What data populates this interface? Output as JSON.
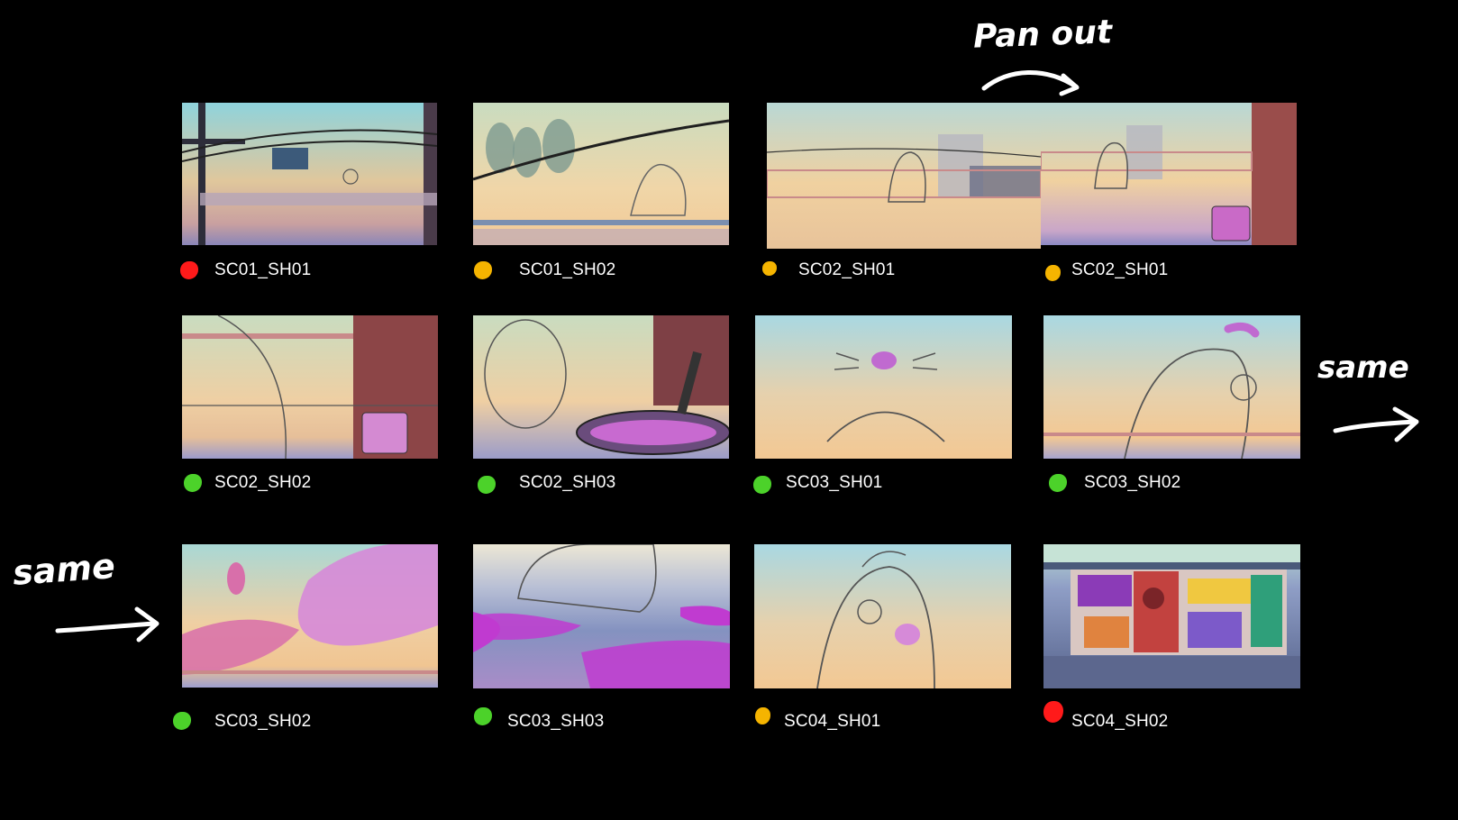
{
  "annotations": {
    "pan_out": "Pan out",
    "same_right": "same",
    "same_left": "same"
  },
  "status_colors": {
    "red": "#ff1a1a",
    "yellow": "#f5b400",
    "green": "#4cd22a"
  },
  "shots": [
    {
      "label": "SC01_SH01",
      "status": "red"
    },
    {
      "label": "SC01_SH02",
      "status": "yellow"
    },
    {
      "label": "SC02_SH01",
      "status": "yellow"
    },
    {
      "label": "SC02_SH01",
      "status": "yellow"
    },
    {
      "label": "SC02_SH02",
      "status": "green"
    },
    {
      "label": "SC02_SH03",
      "status": "green"
    },
    {
      "label": "SC03_SH01",
      "status": "green"
    },
    {
      "label": "SC03_SH02",
      "status": "green"
    },
    {
      "label": "SC03_SH02",
      "status": "green"
    },
    {
      "label": "SC03_SH03",
      "status": "green"
    },
    {
      "label": "SC04_SH01",
      "status": "yellow"
    },
    {
      "label": "SC04_SH02",
      "status": "red"
    }
  ]
}
